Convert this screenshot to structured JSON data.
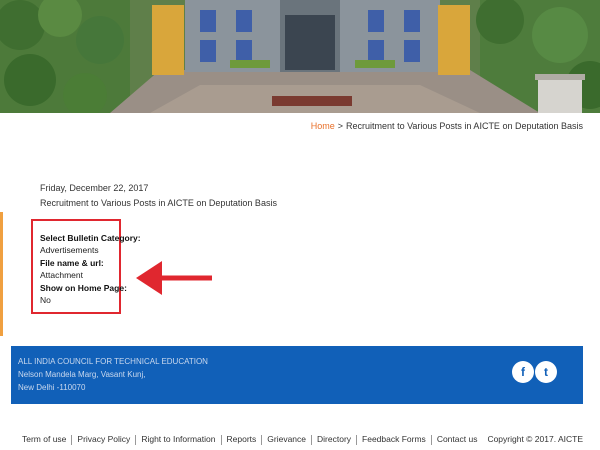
{
  "breadcrumb": {
    "home": "Home",
    "separator": ">",
    "current": "Recruitment to Various Posts in AICTE on Deputation Basis"
  },
  "bulletin": {
    "date": "Friday, December 22, 2017",
    "title": "Recruitment to Various Posts in AICTE on Deputation Basis",
    "fields": [
      {
        "label": "Select Bulletin Category:",
        "value": "Advertisements"
      },
      {
        "label": "File name & url:",
        "value": "Attachment"
      },
      {
        "label": "Show on Home Page:",
        "value": "No"
      }
    ]
  },
  "footer": {
    "org": "ALL INDIA COUNCIL FOR TECHNICAL EDUCATION",
    "address_line1": "Nelson Mandela Marg, Vasant Kunj,",
    "address_line2": "New Delhi -110070",
    "social": [
      {
        "name": "facebook",
        "glyph": "f"
      },
      {
        "name": "twitter",
        "glyph": "t"
      }
    ]
  },
  "bottom_links": [
    "Term of use",
    "Privacy Policy",
    "Right to Information",
    "Reports",
    "Grievance",
    "Directory",
    "Feedback Forms",
    "Contact us"
  ],
  "copyright": "Copyright © 2017. AICTE",
  "colors": {
    "accent": "#e8702a",
    "highlight": "#e0272f",
    "footer": "#1160b8"
  }
}
